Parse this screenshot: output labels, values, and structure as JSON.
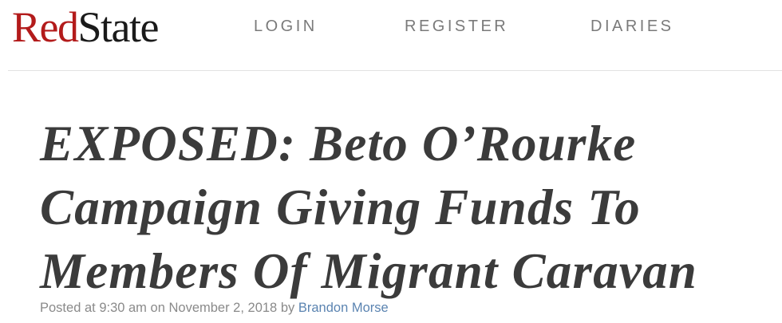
{
  "header": {
    "logo": {
      "part1": "Red",
      "part2": "State"
    },
    "nav": {
      "login": "LOGIN",
      "register": "REGISTER",
      "diaries": "DIARIES"
    }
  },
  "article": {
    "headline_lines": [
      "EXPOSED: Beto O’Rourke",
      "Campaign Giving Funds To",
      "Members Of Migrant Caravan"
    ],
    "byline": {
      "posted_at_prefix": "Posted at",
      "time": "9:30 am",
      "on": "on",
      "date": "November 2, 2018",
      "by": "by",
      "author": "Brandon Morse"
    }
  },
  "colors": {
    "brand_red": "#b31b1b",
    "author_link": "#5b84b1",
    "headline": "#3b3b3b"
  }
}
